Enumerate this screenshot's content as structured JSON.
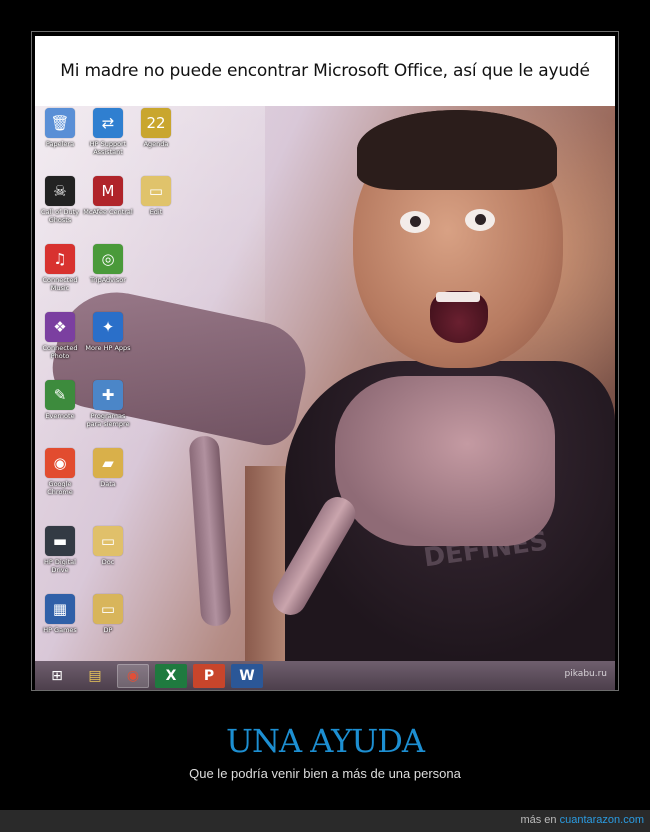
{
  "caption": "Mi madre no puede encontrar Microsoft Office, así que le ayudé",
  "desktop": {
    "icons": [
      {
        "label": "Papelera",
        "glyph": "🗑",
        "color": "#5a8fd6"
      },
      {
        "label": "Call of Duty Ghosts",
        "glyph": "☠",
        "color": "#222222"
      },
      {
        "label": "Connected Music",
        "glyph": "♫",
        "color": "#d8322f"
      },
      {
        "label": "Connected Photo",
        "glyph": "❖",
        "color": "#7b3fa0"
      },
      {
        "label": "Evernote",
        "glyph": "✎",
        "color": "#3d8b3d"
      },
      {
        "label": "Google Chrome",
        "glyph": "◉",
        "color": "#e24c2f"
      },
      {
        "label": "HP Digital Drive",
        "glyph": "▬",
        "color": "#333a44"
      },
      {
        "label": "HP Games",
        "glyph": "▦",
        "color": "#3060a8"
      },
      {
        "label": "HP Support Assistant",
        "glyph": "⇄",
        "color": "#2f7fd0"
      },
      {
        "label": "McAfee Central",
        "glyph": "M",
        "color": "#b0242a"
      },
      {
        "label": "TripAdvisor",
        "glyph": "◎",
        "color": "#4a9a3a"
      },
      {
        "label": "More HP Apps",
        "glyph": "✦",
        "color": "#2a6fc9"
      },
      {
        "label": "Programas para siempre",
        "glyph": "✚",
        "color": "#4b86c8"
      },
      {
        "label": "Data",
        "glyph": "▰",
        "color": "#d9b04a"
      },
      {
        "label": "Doc",
        "glyph": "▭",
        "color": "#e0c06a"
      },
      {
        "label": "DP",
        "glyph": "▭",
        "color": "#d8b55b"
      },
      {
        "label": "Agenda",
        "glyph": "22",
        "color": "#c9a62e"
      },
      {
        "label": "Edit",
        "glyph": "▭",
        "color": "#e0c36b"
      }
    ]
  },
  "taskbar": {
    "start_glyph": "⊞",
    "apps": [
      {
        "name": "file-explorer",
        "glyph": "▤",
        "active": false
      },
      {
        "name": "chrome",
        "glyph": "◉",
        "active": true
      },
      {
        "name": "excel",
        "glyph": "X",
        "active": false
      },
      {
        "name": "powerpoint",
        "glyph": "P",
        "active": false
      },
      {
        "name": "word",
        "glyph": "W",
        "active": false
      }
    ],
    "watermark": "pikabu.ru"
  },
  "shirt_text": "MUSIC\nDEFINES",
  "headline": "UNA AYUDA",
  "subline": "Que le podría venir bien a más de una persona",
  "footer": {
    "prefix": "más en ",
    "link": "cuantarazon.com"
  },
  "colors": {
    "headline": "#1d8fd2",
    "footer_link": "#2b9be0",
    "background": "#000000"
  }
}
